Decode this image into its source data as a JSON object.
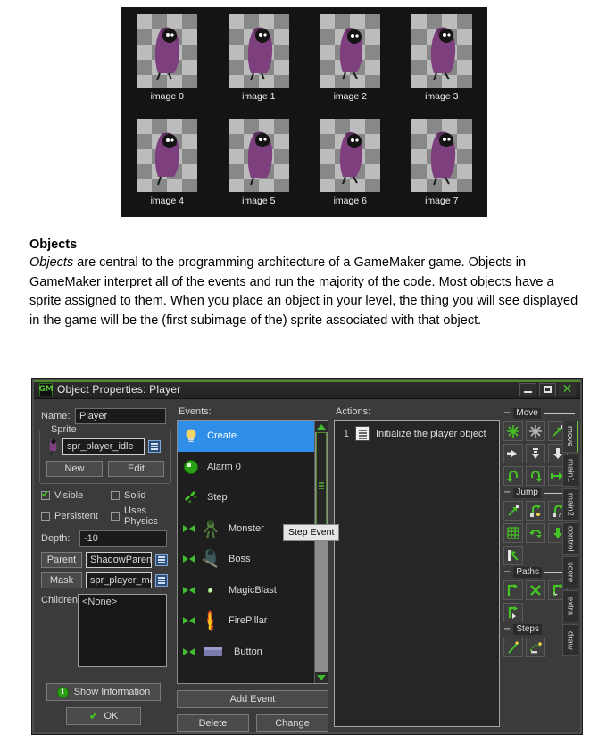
{
  "sprite_strip": {
    "images": [
      {
        "label": "image 0"
      },
      {
        "label": "image 1"
      },
      {
        "label": "image 2"
      },
      {
        "label": "image 3"
      },
      {
        "label": "image 4"
      },
      {
        "label": "image 5"
      },
      {
        "label": "image 6"
      },
      {
        "label": "image 7"
      }
    ]
  },
  "article": {
    "heading": "Objects",
    "lead_italic": "Objects",
    "body": " are central to the programming architecture of a GameMaker game. Objects in GameMaker interpret all of the events and run the majority of the code. Most objects have a sprite assigned to them. When you place an object in your level, the thing you will see displayed in the game will be the (first subimage of the) sprite associated with that object."
  },
  "window": {
    "title": "Object Properties: Player",
    "icon": "gamemaker-icon",
    "minimize": "minimize-button",
    "maximize": "maximize-button",
    "close": "close-button"
  },
  "properties": {
    "name_label": "Name:",
    "name_value": "Player",
    "sprite_group_title": "Sprite",
    "sprite_value": "spr_player_idle",
    "sprite_new": "New",
    "sprite_edit": "Edit",
    "checkboxes": [
      {
        "label": "Visible",
        "checked": true
      },
      {
        "label": "Solid",
        "checked": false
      },
      {
        "label": "Persistent",
        "checked": false
      },
      {
        "label": "Uses Physics",
        "checked": false
      }
    ],
    "depth_label": "Depth:",
    "depth_value": "-10",
    "parent_label": "Parent",
    "parent_value": "ShadowParent",
    "mask_label": "Mask",
    "mask_value": "spr_player_mask",
    "children_label": "Children:",
    "children_value": "<None>",
    "show_information": "Show Information",
    "ok": "OK"
  },
  "events": {
    "label": "Events:",
    "items": [
      {
        "name": "Create",
        "icon": "lightbulb-icon",
        "selected": true,
        "type": "normal"
      },
      {
        "name": "Alarm 0",
        "icon": "alarm-clock-icon",
        "selected": false,
        "type": "normal"
      },
      {
        "name": "Step",
        "icon": "step-footprints-icon",
        "selected": false,
        "type": "normal"
      },
      {
        "name": "Monster",
        "icon": "monster-sprite-icon",
        "selected": false,
        "type": "collision"
      },
      {
        "name": "Boss",
        "icon": "boss-sprite-icon",
        "selected": false,
        "type": "collision"
      },
      {
        "name": "MagicBlast",
        "icon": "magicblast-sprite-icon",
        "selected": false,
        "type": "collision"
      },
      {
        "name": "FirePillar",
        "icon": "firepillar-sprite-icon",
        "selected": false,
        "type": "collision"
      },
      {
        "name": "Button",
        "icon": "button-sprite-icon",
        "selected": false,
        "type": "collision"
      }
    ],
    "add_event": "Add Event",
    "delete": "Delete",
    "change": "Change",
    "tooltip": "Step Event"
  },
  "actions": {
    "label": "Actions:",
    "items": [
      {
        "number": "1",
        "text": "Initialize the player object",
        "icon": "code-block-icon"
      }
    ]
  },
  "toolbar": {
    "groups": [
      {
        "name": "Move",
        "icons": [
          "move-fixed-icon",
          "move-free-icon",
          "move-towards-icon",
          "speed-horizontal-icon",
          "speed-vertical-icon",
          "gravity-icon",
          "reverse-horizontal-icon",
          "reverse-vertical-icon",
          "friction-icon"
        ]
      },
      {
        "name": "Jump",
        "icons": [
          "jump-position-icon",
          "jump-start-icon",
          "jump-random-icon",
          "align-grid-icon",
          "wrap-screen-icon",
          "move-contact-icon",
          "bounce-icon"
        ]
      },
      {
        "name": "Paths",
        "icons": [
          "set-path-icon",
          "end-path-icon",
          "path-position-icon",
          "path-speed-icon"
        ]
      },
      {
        "name": "Steps",
        "icons": [
          "step-towards-icon",
          "step-avoiding-icon"
        ]
      }
    ]
  },
  "tabs": [
    {
      "label": "move",
      "active": true
    },
    {
      "label": "main1",
      "active": false
    },
    {
      "label": "main2",
      "active": false
    },
    {
      "label": "control",
      "active": false
    },
    {
      "label": "score",
      "active": false
    },
    {
      "label": "extra",
      "active": false
    },
    {
      "label": "draw",
      "active": false
    }
  ],
  "colors": {
    "accent_green": "#6ec93a",
    "selection_blue": "#2f8fe8",
    "window_bg": "#3b3b3b",
    "field_bg": "#1b1b1b",
    "sprite_purple": "#7e3f7e"
  }
}
